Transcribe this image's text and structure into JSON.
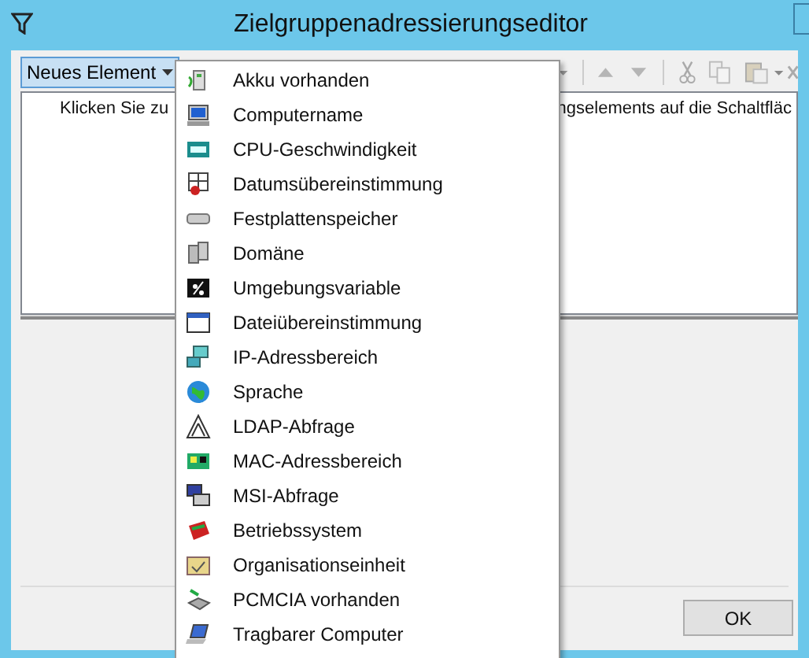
{
  "window": {
    "title": "Zielgruppenadressierungseditor"
  },
  "toolbar": {
    "new_item_button": {
      "label": "Neues Element",
      "pressed": true
    }
  },
  "list_hint": {
    "left_part": "Klicken Sie zu",
    "right_part": "ngselements auf die Schaltfläc"
  },
  "menu": {
    "items": [
      {
        "label": "Akku vorhanden"
      },
      {
        "label": "Computername"
      },
      {
        "label": "CPU-Geschwindigkeit"
      },
      {
        "label": "Datumsübereinstimmung"
      },
      {
        "label": "Festplattenspeicher"
      },
      {
        "label": "Domäne"
      },
      {
        "label": "Umgebungsvariable"
      },
      {
        "label": "Dateiübereinstimmung"
      },
      {
        "label": "IP-Adressbereich"
      },
      {
        "label": "Sprache"
      },
      {
        "label": "LDAP-Abfrage"
      },
      {
        "label": "MAC-Adressbereich"
      },
      {
        "label": "MSI-Abfrage"
      },
      {
        "label": "Betriebssystem"
      },
      {
        "label": "Organisationseinheit"
      },
      {
        "label": "PCMCIA vorhanden"
      },
      {
        "label": "Tragbarer Computer"
      }
    ]
  },
  "buttons": [
    {
      "label": "OK"
    }
  ]
}
